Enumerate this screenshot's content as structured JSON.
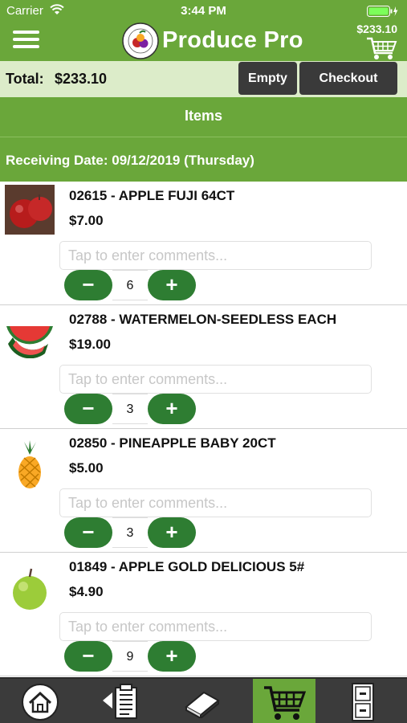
{
  "status_bar": {
    "carrier": "Carrier",
    "time": "3:44 PM"
  },
  "header": {
    "title": "Produce Pro",
    "cart_total": "$233.10"
  },
  "total_bar": {
    "label": "Total:",
    "value": "$233.10",
    "empty_label": "Empty",
    "checkout_label": "Checkout"
  },
  "items_header": "Items",
  "receiving_date": "Receiving Date: 09/12/2019 (Thursday)",
  "comment_placeholder": "Tap to enter comments...",
  "items": [
    {
      "title": "02615 - APPLE FUJI 64CT",
      "price": "$7.00",
      "quantity": "6",
      "icon": "red-apple-icon"
    },
    {
      "title": "02788 - WATERMELON-SEEDLESS EACH",
      "price": "$19.00",
      "quantity": "3",
      "icon": "watermelon-icon"
    },
    {
      "title": "02850 - PINEAPPLE BABY 20CT",
      "price": "$5.00",
      "quantity": "3",
      "icon": "pineapple-icon"
    },
    {
      "title": "01849 - APPLE GOLD DELICIOUS 5#",
      "price": "$4.90",
      "quantity": "9",
      "icon": "green-apple-icon"
    }
  ],
  "stepper": {
    "minus": "−",
    "plus": "+"
  },
  "tabs": [
    {
      "icon": "home-icon",
      "active": false
    },
    {
      "icon": "order-list-icon",
      "active": false
    },
    {
      "icon": "catalog-book-icon",
      "active": false
    },
    {
      "icon": "cart-icon",
      "active": true
    },
    {
      "icon": "cabinet-icon",
      "active": false
    }
  ],
  "colors": {
    "brand_green": "#6aa73a",
    "light_green": "#dcecc9",
    "stepper_green": "#2e7d32",
    "dark_button": "#3a3a3a",
    "tab_bar": "#3b3b3b"
  }
}
